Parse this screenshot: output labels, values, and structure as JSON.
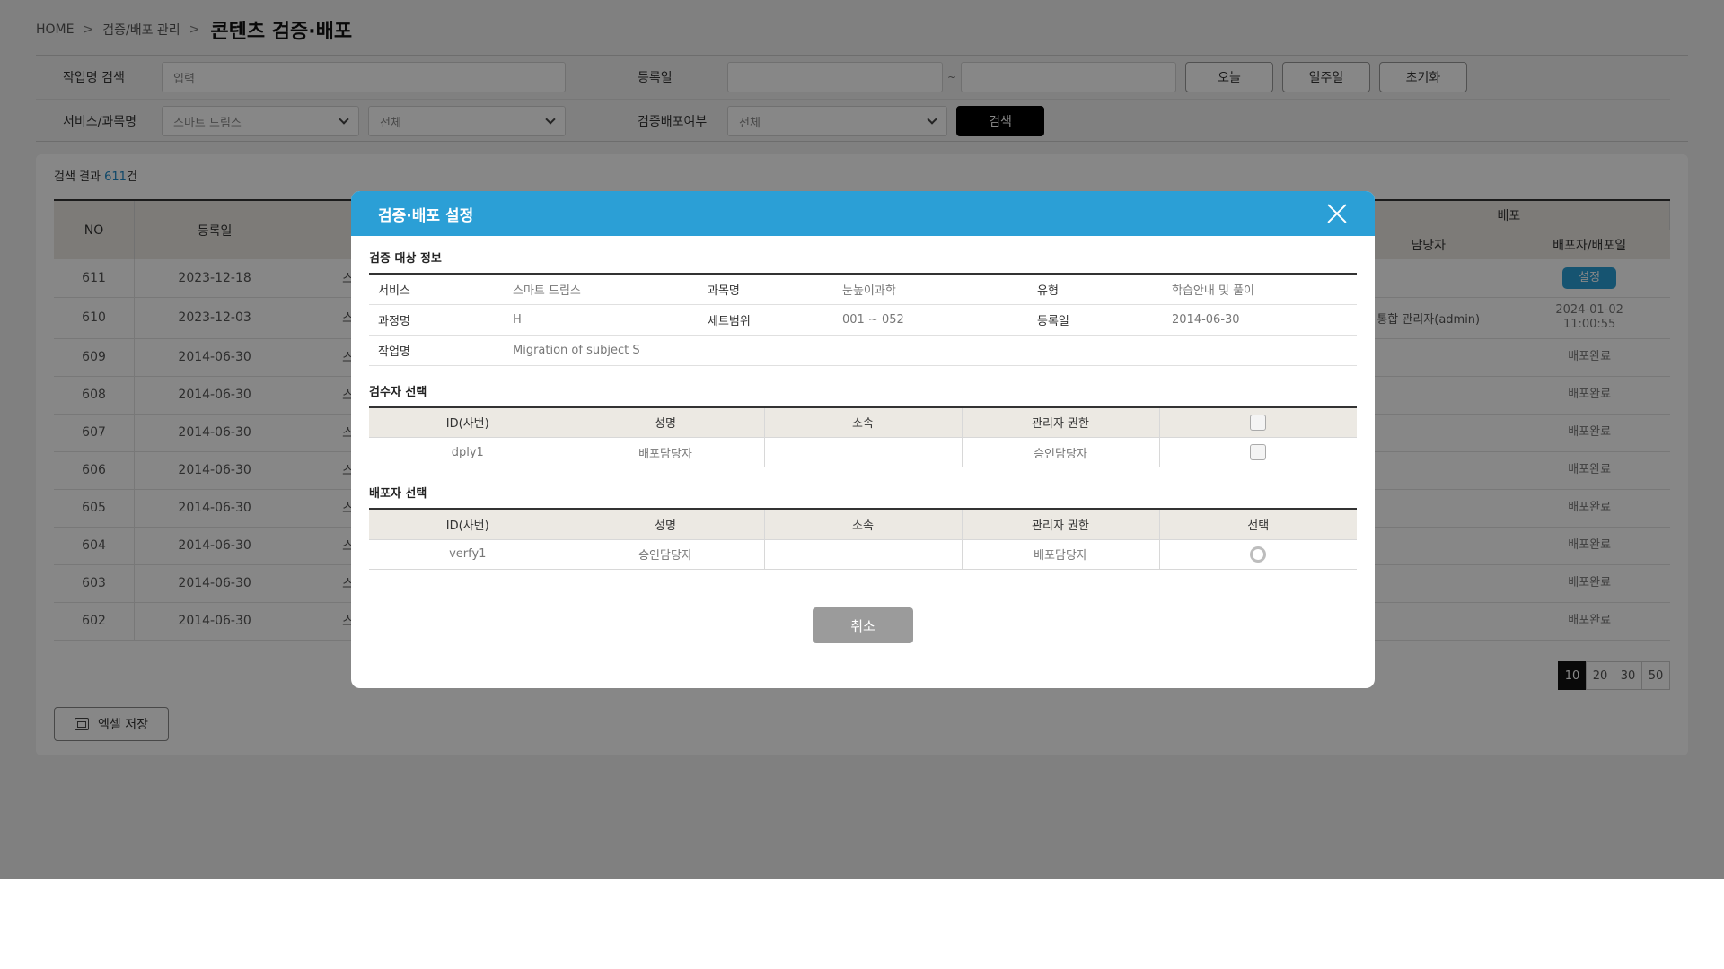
{
  "breadcrumb": {
    "home": "HOME",
    "sep1": ">",
    "section": "검증/배포 관리",
    "sep2": ">",
    "title": "콘텐츠 검증·배포"
  },
  "filters": {
    "job_name_label": "작업명 검색",
    "job_name_placeholder": "입력",
    "reg_date_label": "등록일",
    "date_sep": "~",
    "today_btn": "오늘",
    "week_btn": "일주일",
    "reset_btn": "초기화",
    "service_label": "서비스/과목명",
    "service_value": "스마트 드림스",
    "subject_value": "전체",
    "deploy_status_label": "검증배포여부",
    "deploy_status_value": "전체",
    "search_btn": "검색"
  },
  "results": {
    "prefix": "검색 결과 ",
    "count": "611",
    "suffix": "건",
    "columns": {
      "no": "NO",
      "reg_date": "등록일",
      "deploy_group": "배포",
      "manager": "담당자",
      "deployer_date": "배포자/배포일"
    },
    "rows": [
      {
        "no": "611",
        "date": "2023-12-18",
        "svc": "스",
        "manager": "",
        "deploy": "설정",
        "deploy_time": ""
      },
      {
        "no": "610",
        "date": "2023-12-03",
        "svc": "스",
        "manager": "통합 관리자(admin)",
        "deploy": "2024-01-02",
        "deploy_time": "11:00:55"
      },
      {
        "no": "609",
        "date": "2014-06-30",
        "svc": "스",
        "manager": "",
        "deploy": "배포완료",
        "deploy_time": ""
      },
      {
        "no": "608",
        "date": "2014-06-30",
        "svc": "스",
        "manager": "",
        "deploy": "배포완료",
        "deploy_time": ""
      },
      {
        "no": "607",
        "date": "2014-06-30",
        "svc": "스",
        "manager": "",
        "deploy": "배포완료",
        "deploy_time": ""
      },
      {
        "no": "606",
        "date": "2014-06-30",
        "svc": "스",
        "manager": "",
        "deploy": "배포완료",
        "deploy_time": ""
      },
      {
        "no": "605",
        "date": "2014-06-30",
        "svc": "스",
        "manager": "",
        "deploy": "배포완료",
        "deploy_time": ""
      },
      {
        "no": "604",
        "date": "2014-06-30",
        "svc": "스",
        "manager": "",
        "deploy": "배포완료",
        "deploy_time": ""
      },
      {
        "no": "603",
        "date": "2014-06-30",
        "svc": "스",
        "manager": "",
        "deploy": "배포완료",
        "deploy_time": ""
      },
      {
        "no": "602",
        "date": "2014-06-30",
        "svc": "스",
        "manager": "",
        "deploy": "배포완료",
        "deploy_time": ""
      }
    ],
    "page_sizes": [
      "10",
      "20",
      "30",
      "50"
    ],
    "excel_btn": "엑셀 저장"
  },
  "modal": {
    "title": "검증·배포 설정",
    "target_section": "검증 대상 정보",
    "info": {
      "service_k": "서비스",
      "service_v": "스마트 드림스",
      "subject_k": "과목명",
      "subject_v": "눈높이과학",
      "type_k": "유형",
      "type_v": "학습안내 및 풀이",
      "course_k": "과정명",
      "course_v": "H",
      "set_range_k": "세트범위",
      "set_range_v": "001 ~ 052",
      "reg_date_k": "등록일",
      "reg_date_v": "2014-06-30",
      "job_k": "작업명",
      "job_v": "Migration of subject S"
    },
    "reviewer_section": "검수자 선택",
    "reviewer_headers": {
      "id": "ID(사번)",
      "name": "성명",
      "affiliation": "소속",
      "role": "관리자 권한"
    },
    "reviewers": [
      {
        "id": "dply1",
        "name": "배포담당자",
        "affiliation": "",
        "role": "승인담당자"
      }
    ],
    "deployer_section": "배포자 선택",
    "deployer_headers": {
      "id": "ID(사번)",
      "name": "성명",
      "affiliation": "소속",
      "role": "관리자 권한",
      "select": "선택"
    },
    "deployers": [
      {
        "id": "verfy1",
        "name": "승인담당자",
        "affiliation": "",
        "role": "배포담당자"
      }
    ],
    "cancel_btn": "취소"
  }
}
